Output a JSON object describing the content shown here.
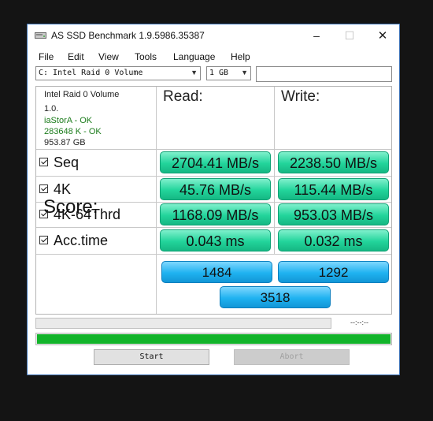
{
  "window": {
    "title": "AS SSD Benchmark 1.9.5986.35387",
    "min_icon": "–",
    "max_icon": "☐",
    "close_icon": "✕"
  },
  "menu": [
    "File",
    "Edit",
    "View",
    "Tools",
    "Language",
    "Help"
  ],
  "drive_select": {
    "value": "C: Intel Raid 0 Volume"
  },
  "size_select": {
    "value": "1 GB"
  },
  "drive_info": {
    "name": "Intel Raid 0 Volume",
    "firmware": "1.0.",
    "driver": "iaStorA - OK",
    "alignment": "283648 K - OK",
    "capacity": "953.87 GB"
  },
  "headers": {
    "read": "Read:",
    "write": "Write:"
  },
  "rows": [
    {
      "label": "Seq",
      "read": "2704.41 MB/s",
      "write": "2238.50 MB/s"
    },
    {
      "label": "4K",
      "read": "45.76 MB/s",
      "write": "115.44 MB/s"
    },
    {
      "label": "4K-64Thrd",
      "read": "1168.09 MB/s",
      "write": "953.03 MB/s"
    },
    {
      "label": "Acc.time",
      "read": "0.043 ms",
      "write": "0.032 ms"
    }
  ],
  "score": {
    "label": "Score:",
    "read": "1484",
    "write": "1292",
    "total": "3518"
  },
  "progress": {
    "time_text": "--:--:--",
    "fraction": 1.0
  },
  "buttons": {
    "start": "Start",
    "abort": "Abort"
  },
  "colors": {
    "result_green": "#22d49b",
    "score_blue": "#1fb2f0",
    "progress_green": "#12b42a"
  }
}
